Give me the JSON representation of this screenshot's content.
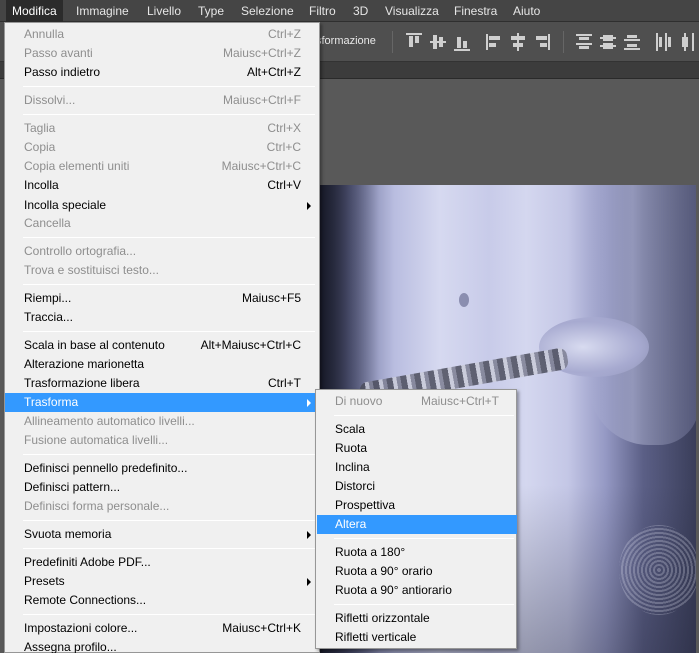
{
  "menubar": {
    "items": [
      "Modifica",
      "Immagine",
      "Livello",
      "Type",
      "Selezione",
      "Filtro",
      "3D",
      "Visualizza",
      "Finestra",
      "Aiuto"
    ]
  },
  "options": {
    "transform_label": "sformazione"
  },
  "edit_menu": {
    "items": [
      {
        "label": "Annulla",
        "shortcut": "Ctrl+Z",
        "disabled": true
      },
      {
        "label": "Passo avanti",
        "shortcut": "Maiusc+Ctrl+Z",
        "disabled": true
      },
      {
        "label": "Passo indietro",
        "shortcut": "Alt+Ctrl+Z",
        "disabled": false
      },
      {
        "label": "Dissolvi...",
        "shortcut": "Maiusc+Ctrl+F",
        "disabled": true
      },
      {
        "label": "Taglia",
        "shortcut": "Ctrl+X",
        "disabled": true
      },
      {
        "label": "Copia",
        "shortcut": "Ctrl+C",
        "disabled": true
      },
      {
        "label": "Copia elementi uniti",
        "shortcut": "Maiusc+Ctrl+C",
        "disabled": true
      },
      {
        "label": "Incolla",
        "shortcut": "Ctrl+V",
        "disabled": false
      },
      {
        "label": "Incolla speciale",
        "shortcut": "",
        "disabled": false,
        "submenu": true
      },
      {
        "label": "Cancella",
        "shortcut": "",
        "disabled": true
      },
      {
        "label": "Controllo ortografia...",
        "shortcut": "",
        "disabled": true
      },
      {
        "label": "Trova e sostituisci testo...",
        "shortcut": "",
        "disabled": true
      },
      {
        "label": "Riempi...",
        "shortcut": "Maiusc+F5",
        "disabled": false
      },
      {
        "label": "Traccia...",
        "shortcut": "",
        "disabled": false
      },
      {
        "label": "Scala in base al contenuto",
        "shortcut": "Alt+Maiusc+Ctrl+C",
        "disabled": false
      },
      {
        "label": "Alterazione marionetta",
        "shortcut": "",
        "disabled": false
      },
      {
        "label": "Trasformazione libera",
        "shortcut": "Ctrl+T",
        "disabled": false
      },
      {
        "label": "Trasforma",
        "shortcut": "",
        "disabled": false,
        "submenu": true,
        "highlighted": true
      },
      {
        "label": "Allineamento automatico livelli...",
        "shortcut": "",
        "disabled": true
      },
      {
        "label": "Fusione automatica livelli...",
        "shortcut": "",
        "disabled": true
      },
      {
        "label": "Definisci pennello predefinito...",
        "shortcut": "",
        "disabled": false
      },
      {
        "label": "Definisci pattern...",
        "shortcut": "",
        "disabled": false
      },
      {
        "label": "Definisci forma personale...",
        "shortcut": "",
        "disabled": true
      },
      {
        "label": "Svuota memoria",
        "shortcut": "",
        "disabled": false,
        "submenu": true
      },
      {
        "label": "Predefiniti Adobe PDF...",
        "shortcut": "",
        "disabled": false
      },
      {
        "label": "Presets",
        "shortcut": "",
        "disabled": false,
        "submenu": true
      },
      {
        "label": "Remote Connections...",
        "shortcut": "",
        "disabled": false
      },
      {
        "label": "Impostazioni colore...",
        "shortcut": "Maiusc+Ctrl+K",
        "disabled": false
      },
      {
        "label": "Assegna profilo...",
        "shortcut": "",
        "disabled": false
      }
    ]
  },
  "transform_submenu": {
    "items": [
      {
        "label": "Di nuovo",
        "shortcut": "Maiusc+Ctrl+T",
        "disabled": true
      },
      {
        "label": "Scala",
        "shortcut": "",
        "disabled": false
      },
      {
        "label": "Ruota",
        "shortcut": "",
        "disabled": false
      },
      {
        "label": "Inclina",
        "shortcut": "",
        "disabled": false
      },
      {
        "label": "Distorci",
        "shortcut": "",
        "disabled": false
      },
      {
        "label": "Prospettiva",
        "shortcut": "",
        "disabled": false
      },
      {
        "label": "Altera",
        "shortcut": "",
        "disabled": false,
        "highlighted": true
      },
      {
        "label": "Ruota a 180°",
        "shortcut": "",
        "disabled": false
      },
      {
        "label": "Ruota a 90° orario",
        "shortcut": "",
        "disabled": false
      },
      {
        "label": "Ruota a 90° antiorario",
        "shortcut": "",
        "disabled": false
      },
      {
        "label": "Rifletti orizzontale",
        "shortcut": "",
        "disabled": false
      },
      {
        "label": "Rifletti verticale",
        "shortcut": "",
        "disabled": false
      }
    ]
  },
  "colors": {
    "highlight": "#3399ff",
    "menu_bg": "#f0f0f0",
    "disabled_text": "#8e8e8e"
  }
}
